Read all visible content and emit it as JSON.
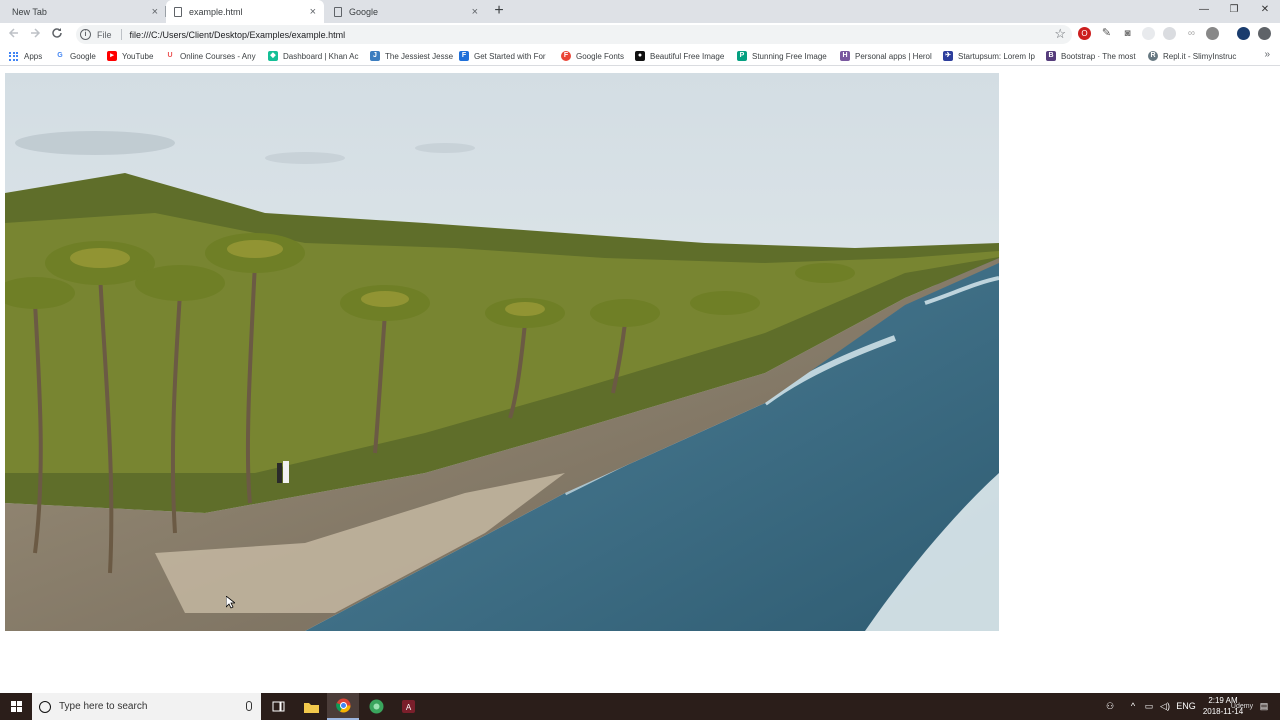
{
  "browser": {
    "tabs": [
      {
        "label": "New Tab"
      },
      {
        "label": "example.html"
      },
      {
        "label": "Google"
      }
    ],
    "close_glyph": "×",
    "new_tab_glyph": "+",
    "window_controls": {
      "minimize": "—",
      "restore": "❐",
      "close": "✕"
    },
    "address": {
      "scheme_label": "File",
      "url": "file:///C:/Users/Client/Desktop/Examples/example.html"
    },
    "bookmarks": [
      {
        "label": "Apps",
        "icon": "apps-grid-icon",
        "color": "#4285f4"
      },
      {
        "label": "Google",
        "icon": "google-icon",
        "color": "#4285f4"
      },
      {
        "label": "YouTube",
        "icon": "youtube-icon",
        "color": "#ff0000"
      },
      {
        "label": "Online Courses - Any",
        "icon": "udemy-icon",
        "color": "#ec5252"
      },
      {
        "label": "Dashboard | Khan Ac",
        "icon": "khan-academy-icon",
        "color": "#14bf96"
      },
      {
        "label": "The Jessiest Jesse",
        "icon": "jesse-icon",
        "color": "#3b7dbf"
      },
      {
        "label": "Get Started with For",
        "icon": "formspree-icon",
        "color": "#1e6fd9"
      },
      {
        "label": "Google Fonts",
        "icon": "google-fonts-icon",
        "color": "#ea4335"
      },
      {
        "label": "Beautiful Free Image",
        "icon": "camera-icon",
        "color": "#111111"
      },
      {
        "label": "Stunning Free Image",
        "icon": "pexels-icon",
        "color": "#05a081"
      },
      {
        "label": "Personal apps | Herol",
        "icon": "heroku-icon",
        "color": "#79589f"
      },
      {
        "label": "Startupsum: Lorem Ip",
        "icon": "startupsum-icon",
        "color": "#2d3e9c"
      },
      {
        "label": "Bootstrap · The most",
        "icon": "bootstrap-icon",
        "color": "#563d7c"
      },
      {
        "label": "Repl.it - SlimyInstruc",
        "icon": "replit-icon",
        "color": "#667881"
      }
    ],
    "bookmarks_more_glyph": "»"
  },
  "page": {
    "image": {
      "subject": "aerial view of palm-lined tropical beach",
      "colors": {
        "sky": "#dbe6ec",
        "palms": "#6b7a2a",
        "sand": "#bfae95",
        "sea": "#3d6f86"
      }
    }
  },
  "taskbar": {
    "search_placeholder": "Type here to search",
    "tray": {
      "language": "ENG",
      "time": "2:19 AM",
      "date": "2018-11-14",
      "watermark": "Udemy"
    }
  }
}
